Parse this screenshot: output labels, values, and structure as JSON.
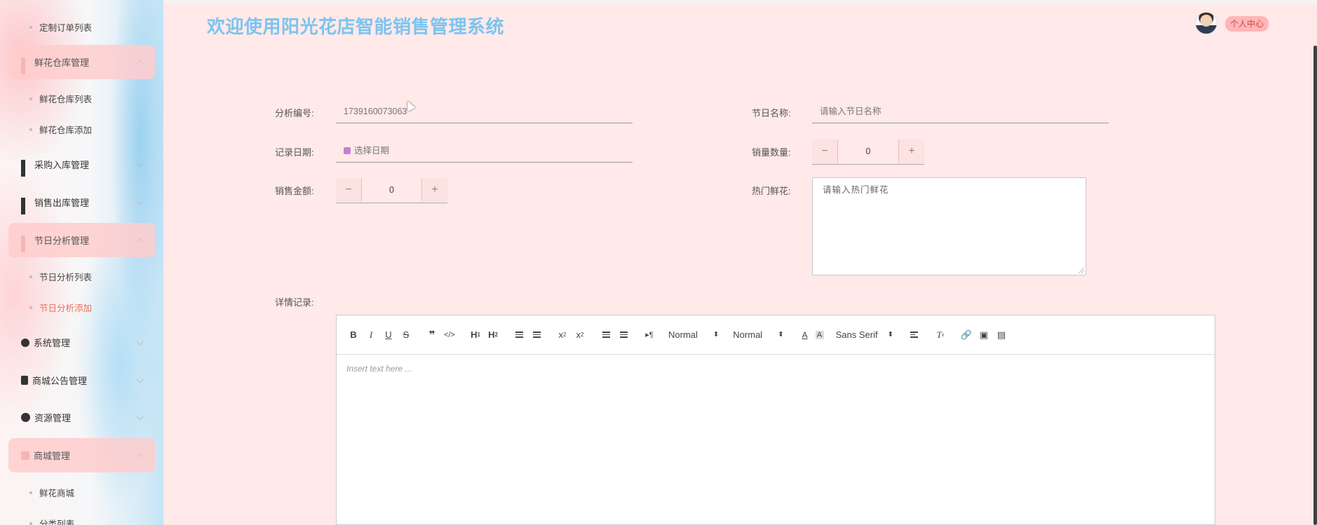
{
  "app": {
    "title": "欢迎使用阳光花店智能销售管理系统",
    "personal_center": "个人中心"
  },
  "sidebar": {
    "items": [
      {
        "type": "sub",
        "label": "定制订单列表"
      },
      {
        "type": "group",
        "label": "鲜花仓库管理",
        "open": true
      },
      {
        "type": "sub",
        "label": "鲜花仓库列表"
      },
      {
        "type": "sub",
        "label": "鲜花仓库添加"
      },
      {
        "type": "group",
        "label": "采购入库管理",
        "open": false
      },
      {
        "type": "group",
        "label": "销售出库管理",
        "open": false
      },
      {
        "type": "group",
        "label": "节日分析管理",
        "open": true
      },
      {
        "type": "sub",
        "label": "节日分析列表"
      },
      {
        "type": "sub",
        "label": "节日分析添加",
        "active": true
      },
      {
        "type": "group",
        "label": "系统管理",
        "open": false
      },
      {
        "type": "group",
        "label": "商城公告管理",
        "open": false
      },
      {
        "type": "group",
        "label": "资源管理",
        "open": false
      },
      {
        "type": "group",
        "label": "商城管理",
        "open": true
      },
      {
        "type": "sub",
        "label": "鲜花商城"
      },
      {
        "type": "sub",
        "label": "分类列表"
      }
    ]
  },
  "form": {
    "analysis_no": {
      "label": "分析编号:",
      "value": "1739160073063"
    },
    "holiday_name": {
      "label": "节日名称:",
      "placeholder": "请输入节日名称"
    },
    "record_date": {
      "label": "记录日期:",
      "placeholder": "选择日期"
    },
    "sales_qty": {
      "label": "销量数量:",
      "value": "0"
    },
    "sales_amount": {
      "label": "销售金额:",
      "value": "0"
    },
    "hot_flowers": {
      "label": "热门鲜花:",
      "placeholder": "请输入热门鲜花"
    },
    "detail": {
      "label": "详情记录:"
    }
  },
  "editor": {
    "header_select": "Normal",
    "size_select": "Normal",
    "font_select": "Sans Serif",
    "placeholder": "Insert text here ..."
  },
  "colors": {
    "background": "#ffe9e9",
    "title": "#7cc4ef",
    "active_menu": "#f36b5a",
    "open_group_bg": "#ffcdcd"
  }
}
